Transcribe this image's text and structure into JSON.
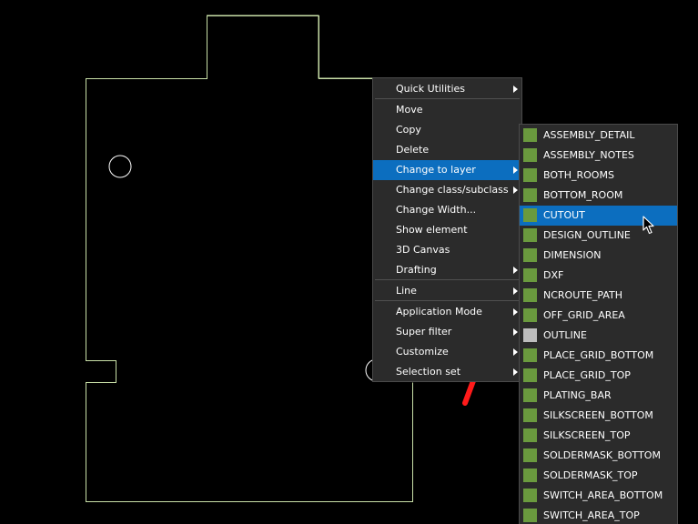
{
  "context_menu": {
    "items": [
      {
        "label": "Quick Utilities",
        "submenu": true
      },
      {
        "label": "Move"
      },
      {
        "label": "Copy"
      },
      {
        "label": "Delete"
      },
      {
        "label": "Change to layer",
        "submenu": true,
        "highlighted": true
      },
      {
        "label": "Change class/subclass",
        "submenu": true
      },
      {
        "label": "Change Width..."
      },
      {
        "label": "Show element"
      },
      {
        "label": "3D Canvas"
      },
      {
        "label": "Drafting",
        "submenu": true
      },
      {
        "label": "Line",
        "submenu": true
      },
      {
        "label": "Application Mode",
        "submenu": true
      },
      {
        "label": "Super filter",
        "submenu": true
      },
      {
        "label": "Customize",
        "submenu": true
      },
      {
        "label": "Selection set",
        "submenu": true
      }
    ]
  },
  "layer_submenu": {
    "items": [
      {
        "label": "ASSEMBLY_DETAIL",
        "color": "#6a9a3e"
      },
      {
        "label": "ASSEMBLY_NOTES",
        "color": "#6a9a3e"
      },
      {
        "label": "BOTH_ROOMS",
        "color": "#6a9a3e"
      },
      {
        "label": "BOTTOM_ROOM",
        "color": "#6a9a3e"
      },
      {
        "label": "CUTOUT",
        "color": "#6a9a3e",
        "highlighted": true
      },
      {
        "label": "DESIGN_OUTLINE",
        "color": "#6a9a3e"
      },
      {
        "label": "DIMENSION",
        "color": "#6a9a3e"
      },
      {
        "label": "DXF",
        "color": "#6a9a3e"
      },
      {
        "label": "NCROUTE_PATH",
        "color": "#6a9a3e"
      },
      {
        "label": "OFF_GRID_AREA",
        "color": "#6a9a3e"
      },
      {
        "label": "OUTLINE",
        "color": "#bdbdbd"
      },
      {
        "label": "PLACE_GRID_BOTTOM",
        "color": "#6a9a3e"
      },
      {
        "label": "PLACE_GRID_TOP",
        "color": "#6a9a3e"
      },
      {
        "label": "PLATING_BAR",
        "color": "#6a9a3e"
      },
      {
        "label": "SILKSCREEN_BOTTOM",
        "color": "#6a9a3e"
      },
      {
        "label": "SILKSCREEN_TOP",
        "color": "#6a9a3e"
      },
      {
        "label": "SOLDERMASK_BOTTOM",
        "color": "#6a9a3e"
      },
      {
        "label": "SOLDERMASK_TOP",
        "color": "#6a9a3e"
      },
      {
        "label": "SWITCH_AREA_BOTTOM",
        "color": "#6a9a3e"
      },
      {
        "label": "SWITCH_AREA_TOP",
        "color": "#6a9a3e"
      }
    ]
  },
  "colors": {
    "board_outline": "#c9e0a8",
    "highlight": "#0c6ebf",
    "annotation_arrow": "#ff1a1a"
  }
}
